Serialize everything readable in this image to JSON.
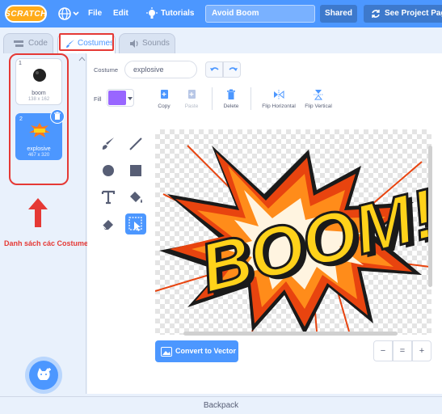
{
  "menubar": {
    "logo_text": "SCRATCH",
    "file_label": "File",
    "edit_label": "Edit",
    "tutorials_label": "Tutorials",
    "project_title": "Avoid Boom",
    "shared_label": "Shared",
    "see_project_label": "See Project Page"
  },
  "tabs": {
    "code_label": "Code",
    "costumes_label": "Costumes",
    "sounds_label": "Sounds",
    "active": "costumes"
  },
  "costume_list": [
    {
      "number": "1",
      "name": "boom",
      "size": "138 x 162"
    },
    {
      "number": "2",
      "name": "explosive",
      "size": "467 x 320"
    }
  ],
  "annotation": {
    "label": "Danh sách các Costume",
    "color": "#e53935"
  },
  "editor": {
    "costume_label": "Costume",
    "costume_name": "explosive",
    "fill_label": "Fill",
    "fill_color": "#9966ff",
    "copy_label": "Copy",
    "paste_label": "Paste",
    "delete_label": "Delete",
    "flip_h_label": "Flip Horizontal",
    "flip_v_label": "Flip Vertical",
    "artwork_text": "BOOM!",
    "convert_label": "Convert to Vector",
    "zoom_out": "−",
    "zoom_reset": "=",
    "zoom_in": "+"
  },
  "backpack_label": "Backpack",
  "colors": {
    "accent": "#4c97ff",
    "menubar": "#4c97ff",
    "annotation": "#e53935"
  }
}
